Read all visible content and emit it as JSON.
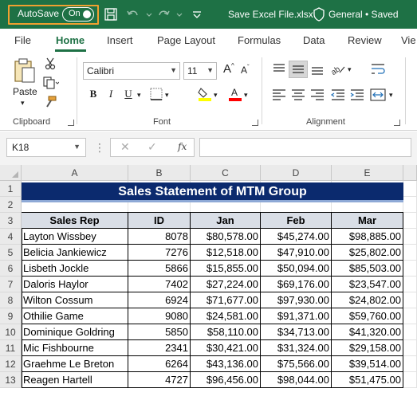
{
  "titlebar": {
    "autosave_label": "AutoSave",
    "autosave_state": "On",
    "file_name": "Save Excel File.xlsx",
    "status": "General • Saved",
    "brand_color": "#1e7145"
  },
  "tabs": [
    {
      "label": "File"
    },
    {
      "label": "Home",
      "active": true
    },
    {
      "label": "Insert"
    },
    {
      "label": "Page Layout"
    },
    {
      "label": "Formulas"
    },
    {
      "label": "Data"
    },
    {
      "label": "Review"
    },
    {
      "label": "Vie"
    }
  ],
  "ribbon": {
    "clipboard": {
      "paste_label": "Paste",
      "group_label": "Clipboard"
    },
    "font": {
      "font_name": "Calibri",
      "font_size": "11",
      "group_label": "Font",
      "bold": "B",
      "italic": "I",
      "underline": "U",
      "highlight_color": "#ffff00",
      "font_color": "#ff0000"
    },
    "alignment": {
      "group_label": "Alignment"
    }
  },
  "formula_bar": {
    "name_box": "K18",
    "fx_label": "fx",
    "formula": ""
  },
  "sheet": {
    "columns": [
      "A",
      "B",
      "C",
      "D",
      "E"
    ],
    "rows": [
      "1",
      "2",
      "3",
      "4",
      "5",
      "6",
      "7",
      "8",
      "9",
      "10",
      "11",
      "12",
      "13"
    ],
    "title": "Sales Statement of MTM Group",
    "title_bg": "#0b2a6e",
    "header_bg": "#d9dee6",
    "headers": [
      "Sales Rep",
      "ID",
      "Jan",
      "Feb",
      "Mar"
    ],
    "data": [
      [
        "Layton Wissbey",
        "8078",
        "$80,578.00",
        "$45,274.00",
        "$98,885.00"
      ],
      [
        "Belicia Jankiewicz",
        "7276",
        "$12,518.00",
        "$47,910.00",
        "$25,802.00"
      ],
      [
        "Lisbeth Jockle",
        "5866",
        "$15,855.00",
        "$50,094.00",
        "$85,503.00"
      ],
      [
        "Daloris Haylor",
        "7402",
        "$27,224.00",
        "$69,176.00",
        "$23,547.00"
      ],
      [
        "Wilton Cossum",
        "6924",
        "$71,677.00",
        "$97,930.00",
        "$24,802.00"
      ],
      [
        "Othilie Game",
        "9080",
        "$24,581.00",
        "$91,371.00",
        "$59,760.00"
      ],
      [
        "Dominique Goldring",
        "5850",
        "$58,110.00",
        "$34,713.00",
        "$41,320.00"
      ],
      [
        "Mic Fishbourne",
        "2341",
        "$30,421.00",
        "$31,324.00",
        "$29,158.00"
      ],
      [
        "Graehme Le Breton",
        "6264",
        "$43,136.00",
        "$75,566.00",
        "$39,514.00"
      ],
      [
        "Reagen Hartell",
        "4727",
        "$96,456.00",
        "$98,044.00",
        "$51,475.00"
      ]
    ]
  }
}
